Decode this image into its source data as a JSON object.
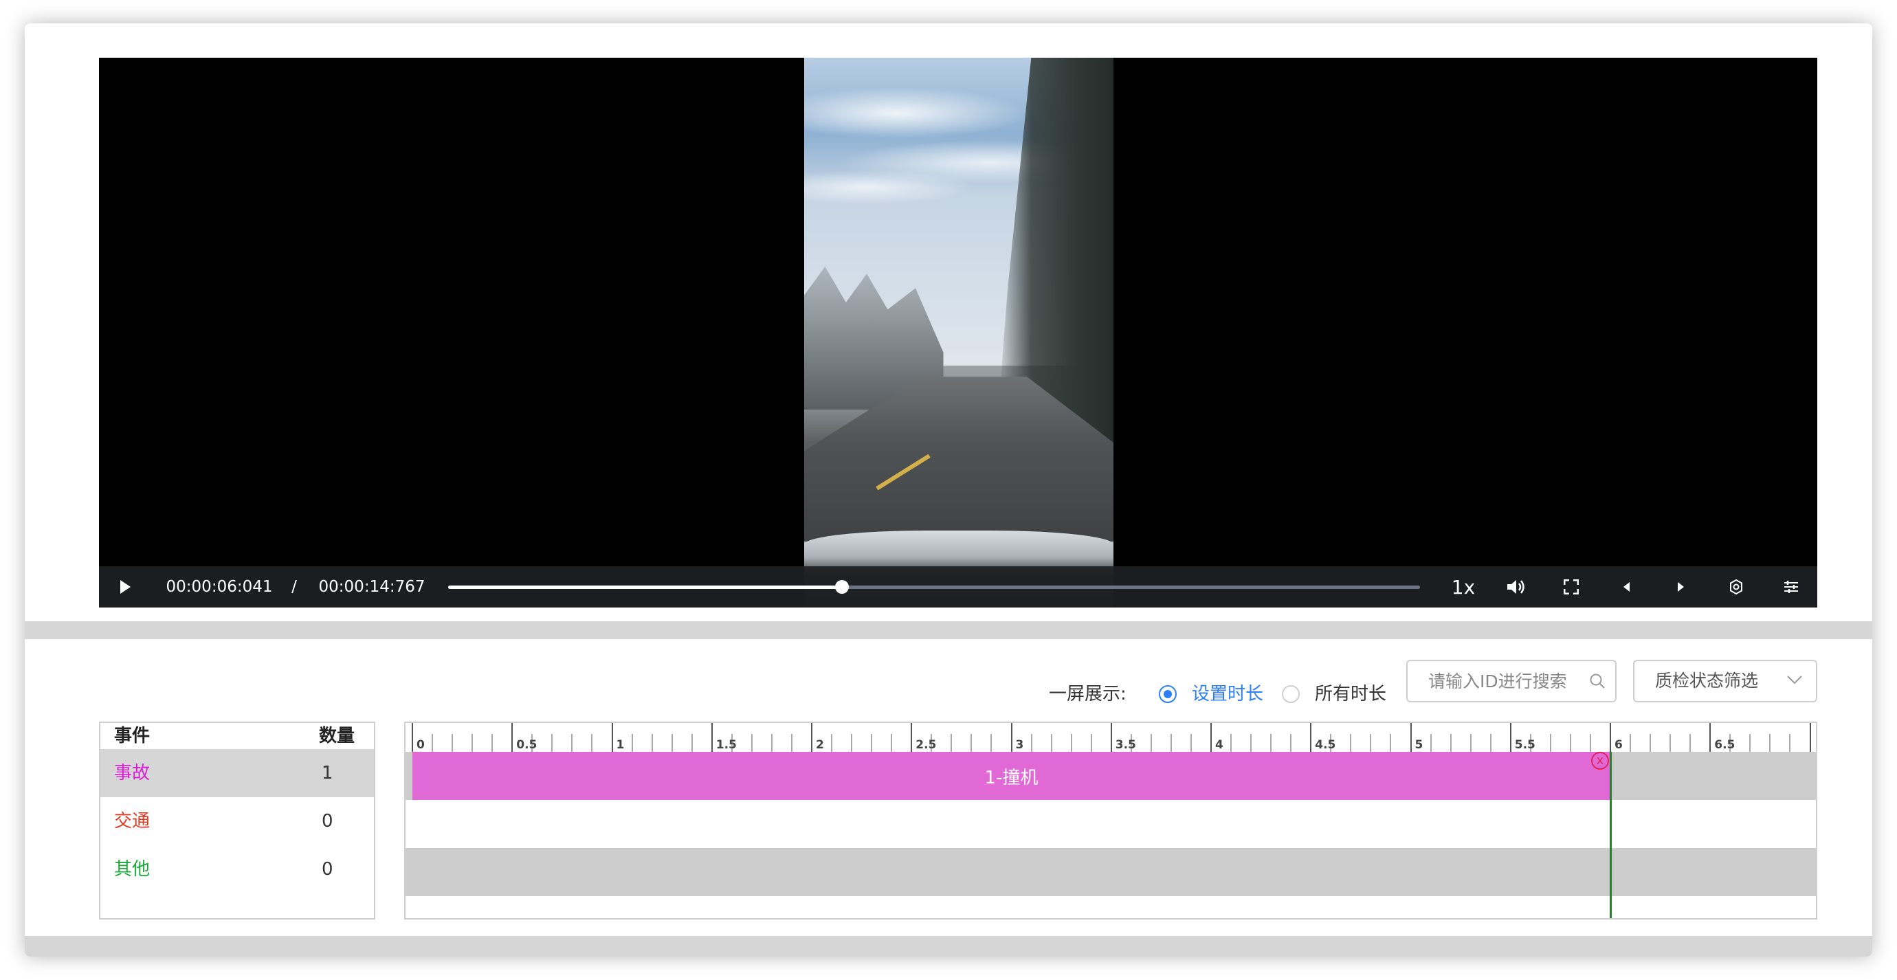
{
  "player": {
    "current_time": "00:00:06:041",
    "separator": "/",
    "total_time": "00:00:14:767",
    "progress": 0.405,
    "speed": "1x",
    "icons": [
      "play-icon",
      "volume-icon",
      "fullscreen-icon",
      "prev-frame-icon",
      "next-frame-icon",
      "settings-icon",
      "adjust-icon"
    ]
  },
  "toolbar": {
    "display_label": "一屏展示:",
    "options": [
      {
        "label": "设置时长",
        "selected": true
      },
      {
        "label": "所有时长",
        "selected": false
      }
    ],
    "search_placeholder": "请输入ID进行搜索",
    "filter_label": "质检状态筛选"
  },
  "events_table": {
    "headers": {
      "event": "事件",
      "count": "数量"
    },
    "rows": [
      {
        "name": "事故",
        "count": "1",
        "color": "#d81fd1",
        "highlighted": true
      },
      {
        "name": "交通",
        "count": "0",
        "color": "#e0391f",
        "highlighted": false
      },
      {
        "name": "其他",
        "count": "0",
        "color": "#1aa838",
        "highlighted": false
      }
    ]
  },
  "timeline": {
    "tick_labels": [
      "0",
      "0.5",
      "1",
      "1.5",
      "2",
      "2.5",
      "3",
      "3.5",
      "4",
      "4.5",
      "5",
      "5.5",
      "6",
      "6.5"
    ],
    "visible_range": [
      0,
      7.0
    ],
    "segment": {
      "label": "1-撞机",
      "start": 0,
      "end": 6.0,
      "color": "#e069d6"
    },
    "playhead": 6.0,
    "delete_mark": "x"
  }
}
